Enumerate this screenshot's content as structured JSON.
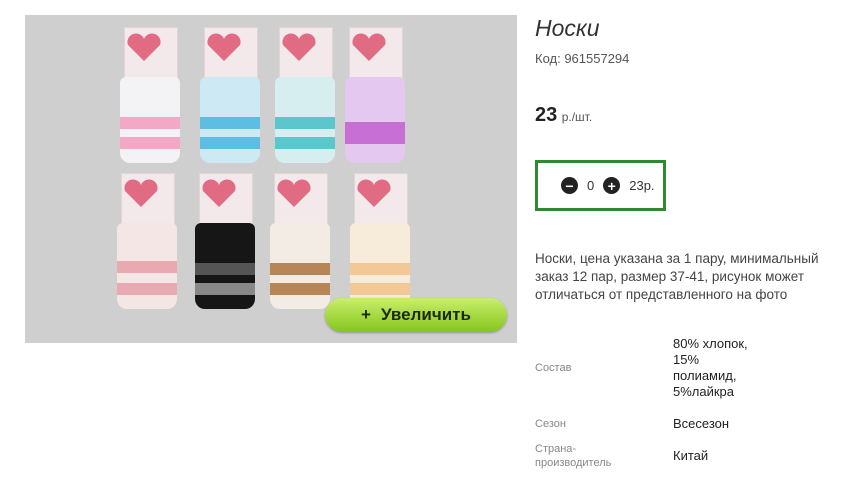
{
  "product": {
    "title": "Носки",
    "code": "Код: 961557294",
    "price_value": "23",
    "price_unit": "р./шт.",
    "zoom": {
      "icon": "+",
      "label": "Увеличить"
    },
    "quantity": {
      "minus_icon": "minus-circle",
      "plus_icon": "plus-circle",
      "value": "0",
      "total": "23р."
    },
    "description": "Носки, цена указана за 1 пару, минимальный заказ 12 пар, размер 37-41, рисунок может отличаться от представленного на фото",
    "specs": [
      {
        "label": "Состав",
        "value": "80% хлопок, 15% полиамид, 5%лайкра"
      },
      {
        "label": "Сезон",
        "value": "Всесезон"
      },
      {
        "label": "Страна-производитель",
        "value": "Китай"
      }
    ]
  },
  "colors": {
    "accent_green": "#2d8a2e",
    "button_green": "#9fd62f"
  }
}
